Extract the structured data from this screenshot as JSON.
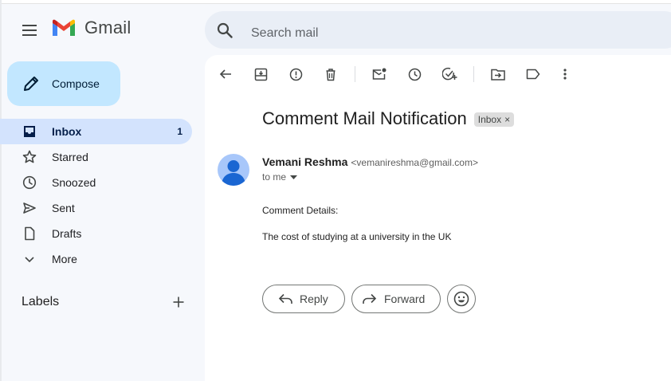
{
  "app": {
    "name": "Gmail"
  },
  "search": {
    "placeholder": "Search mail"
  },
  "sidebar": {
    "compose_label": "Compose",
    "items": [
      {
        "label": "Inbox",
        "count": "1",
        "icon": "inbox-icon",
        "active": true
      },
      {
        "label": "Starred",
        "count": "",
        "icon": "star-icon"
      },
      {
        "label": "Snoozed",
        "count": "",
        "icon": "clock-icon"
      },
      {
        "label": "Sent",
        "count": "",
        "icon": "send-icon"
      },
      {
        "label": "Drafts",
        "count": "",
        "icon": "draft-icon"
      },
      {
        "label": "More",
        "count": "",
        "icon": "chevron-down-icon"
      }
    ],
    "labels_title": "Labels"
  },
  "toolbar": {
    "icons": [
      "back-arrow-icon",
      "archive-icon",
      "report-spam-icon",
      "delete-icon",
      "mark-unread-icon",
      "snooze-icon",
      "add-to-tasks-icon",
      "move-to-icon",
      "label-icon",
      "more-options-icon"
    ]
  },
  "email": {
    "subject": "Comment Mail Notification",
    "chip_label": "Inbox",
    "chip_close": "×",
    "sender_name": "Vemani Reshma",
    "sender_email": "<vemanireshma@gmail.com>",
    "to_label": "to me",
    "body_line1": "Comment Details:",
    "body_line2": "The cost of studying at a university in the UK"
  },
  "actions": {
    "reply_label": "Reply",
    "forward_label": "Forward"
  },
  "colors": {
    "background": "#f6f8fc",
    "compose_bg": "#c2e7ff",
    "active_nav_bg": "#d3e3fd",
    "search_bg": "#e9eef6",
    "avatar_bg": "#a8c7fa",
    "avatar_fg": "#1a66d2"
  }
}
